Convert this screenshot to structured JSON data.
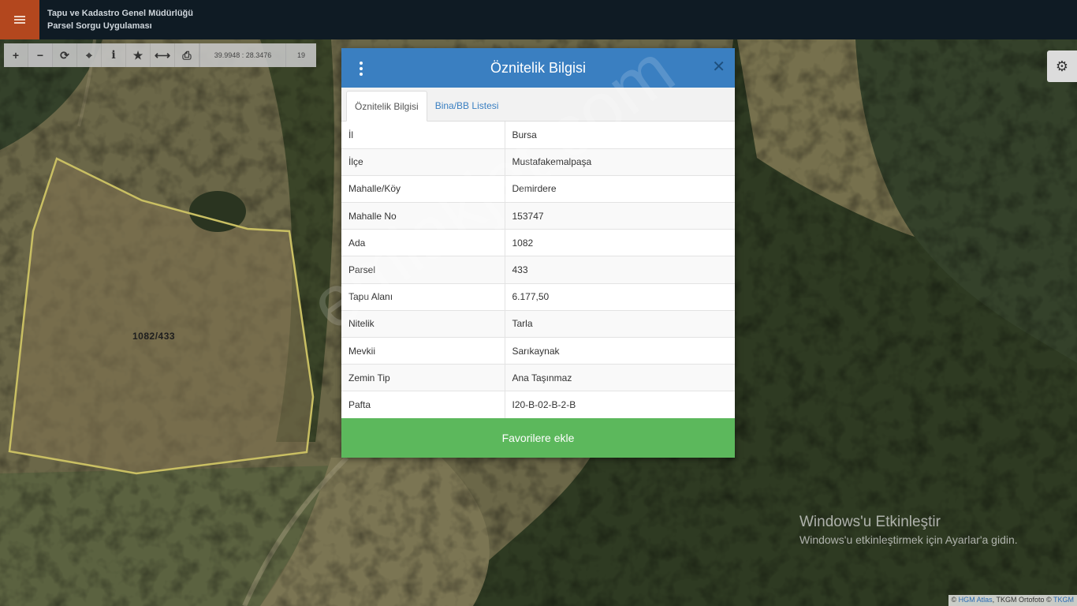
{
  "header": {
    "title_line1": "Tapu ve Kadastro Genel Müdürlüğü",
    "title_line2": "Parsel Sorgu Uygulaması"
  },
  "toolbar": {
    "tools": [
      {
        "name": "zoom-in",
        "glyph": "+"
      },
      {
        "name": "zoom-out",
        "glyph": "−"
      },
      {
        "name": "refresh",
        "glyph": "⟳"
      },
      {
        "name": "locate",
        "glyph": "⌖"
      },
      {
        "name": "info",
        "glyph": "i"
      },
      {
        "name": "favorite",
        "glyph": "★"
      },
      {
        "name": "measure",
        "glyph": "⟷"
      },
      {
        "name": "print",
        "glyph": "⎙"
      }
    ],
    "coordinates": "39.9948 : 28.3476",
    "zoom_level": "19"
  },
  "map": {
    "parcel_label": "1082/433"
  },
  "modal": {
    "title": "Öznitelik Bilgisi",
    "tabs": [
      "Öznitelik Bilgisi",
      "Bina/BB Listesi"
    ],
    "rows": [
      {
        "key": "İl",
        "value": "Bursa"
      },
      {
        "key": "İlçe",
        "value": "Mustafakemalpaşa"
      },
      {
        "key": "Mahalle/Köy",
        "value": "Demirdere"
      },
      {
        "key": "Mahalle No",
        "value": "153747"
      },
      {
        "key": "Ada",
        "value": "1082"
      },
      {
        "key": "Parsel",
        "value": "433"
      },
      {
        "key": "Tapu Alanı",
        "value": "6.177,50"
      },
      {
        "key": "Nitelik",
        "value": "Tarla"
      },
      {
        "key": "Mevkii",
        "value": "Sarıkaynak"
      },
      {
        "key": "Zemin Tip",
        "value": "Ana Taşınmaz"
      },
      {
        "key": "Pafta",
        "value": "I20-B-02-B-2-B"
      }
    ],
    "favorite_button": "Favorilere ekle"
  },
  "watermark": "emlakjet.com",
  "windows_activation": {
    "title": "Windows'u Etkinleştir",
    "subtitle": "Windows'u etkinleştirmek için Ayarlar'a gidin."
  },
  "attribution": {
    "prefix": "©",
    "hgm": "HGM Atlas",
    "middle": ", TKGM Ortofoto ©",
    "tkgm": "TKGM"
  },
  "colors": {
    "header_bg": "#0f1b24",
    "menu_button": "#b3471e",
    "modal_header": "#3a7fc1",
    "favorite_button": "#5cb85c",
    "parcel_outline": "#c9bf63"
  }
}
